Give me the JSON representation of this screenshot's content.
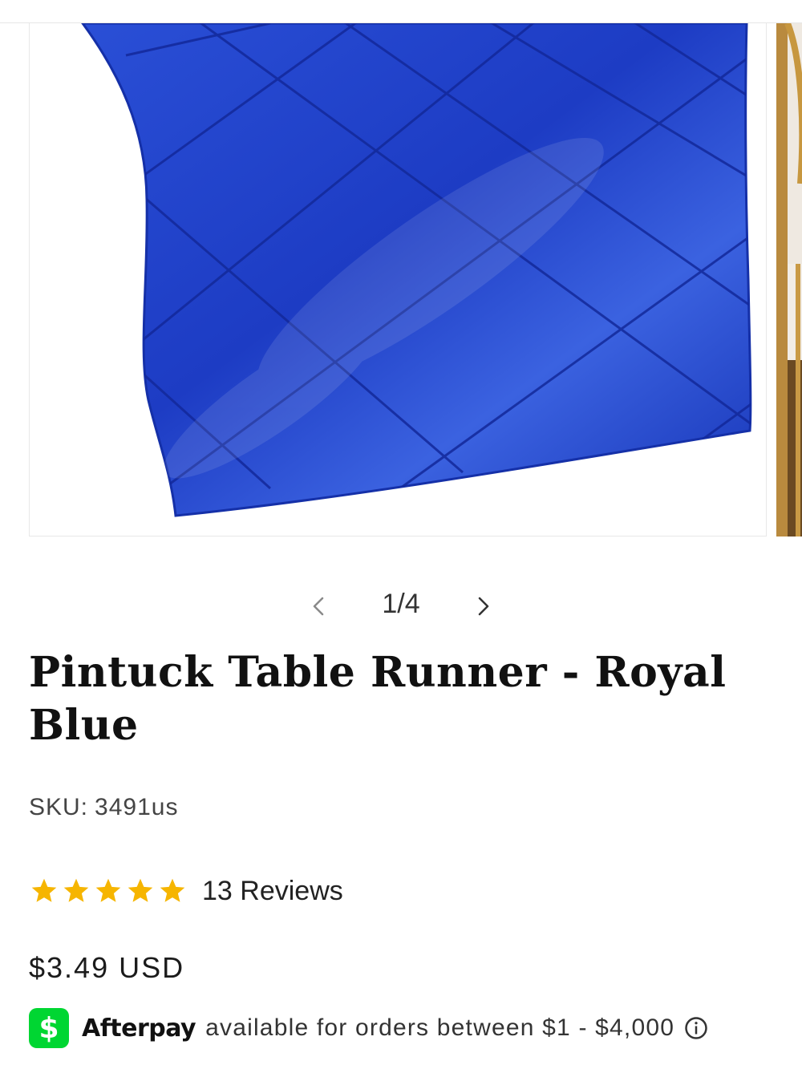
{
  "product": {
    "title": "Pintuck Table Runner - Royal Blue",
    "sku_label": "SKU:",
    "sku_value": "3491us",
    "rating_stars": 5,
    "reviews_label": "13 Reviews",
    "price": "$3.49 USD"
  },
  "gallery": {
    "counter": "1/4",
    "current": 1,
    "total": 4,
    "main_image": "royal-blue-pintuck-table-runner",
    "next_image": "gold-chiavari-chair"
  },
  "icons": {
    "prev": "chevron-left-icon",
    "next": "chevron-right-icon",
    "star": "star-icon",
    "cash": "cash-app-icon",
    "info": "info-icon"
  },
  "afterpay": {
    "icon_glyph": "$",
    "brand": "Afterpay",
    "text": "available for orders between $1 - $4,000"
  },
  "colors": {
    "fabric": "#1f3fc7",
    "star": "#f6b500",
    "cash_green": "#00d632"
  }
}
